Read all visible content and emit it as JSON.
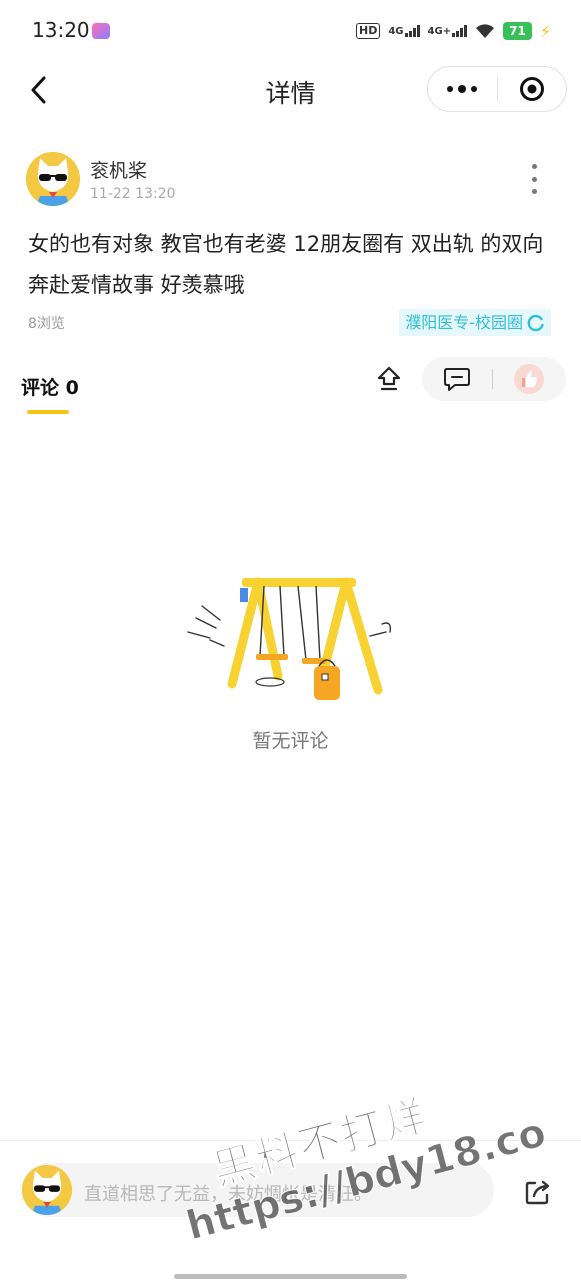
{
  "status_bar": {
    "time": "13:20",
    "hd_label": "HD",
    "net1": "4G",
    "net2": "4G+",
    "battery": "71",
    "icons": [
      "app-icon",
      "hd-icon",
      "signal-icon",
      "signal-icon",
      "wifi-icon",
      "battery-icon",
      "charging-icon"
    ]
  },
  "nav": {
    "title": "详情",
    "back_icon": "chevron-left-icon",
    "more_icon": "more-dots-icon",
    "close_icon": "target-circle-icon"
  },
  "post": {
    "author": "衮杋桨",
    "time": "11-22 13:20",
    "content": "女的也有对象 教官也有老婆 12朋友圈有 双出轨 的双向奔赴爱情故事 好羡慕哦",
    "views": "8浏览",
    "circle_tag": "濮阳医专-校园圈"
  },
  "comments": {
    "tab_label": "评论 0",
    "empty_text": "暂无评论"
  },
  "bottom": {
    "input_placeholder": "直道相思了无益，未妨惆怅是清狂。"
  },
  "watermark": {
    "line1": "黑料不打烊",
    "line2": "https://bdy18.co"
  },
  "colors": {
    "accent_yellow": "#f5c518",
    "tag_text": "#2fbfd6",
    "tag_bg": "#e6f8fb",
    "battery_green": "#38c15a"
  }
}
